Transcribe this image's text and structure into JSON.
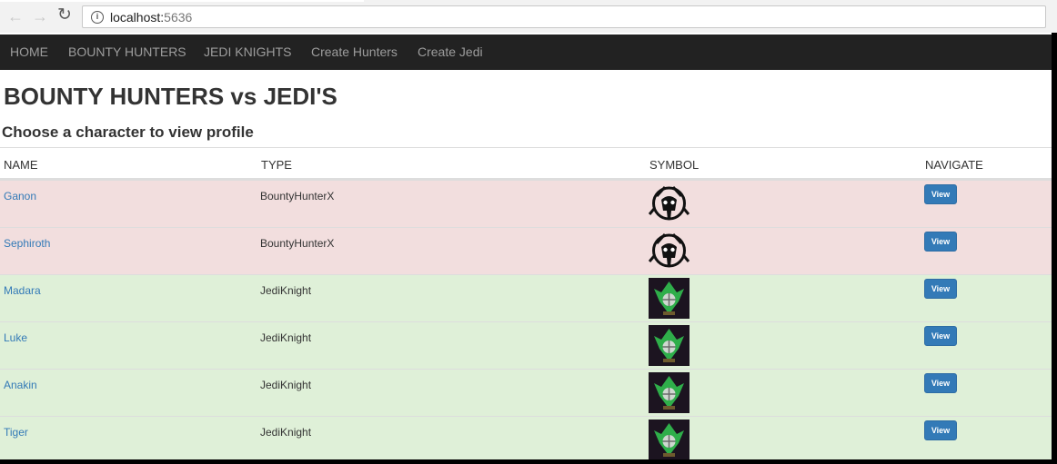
{
  "browser": {
    "url_host": "localhost:",
    "url_port": "5636",
    "icons": {
      "back": "arrow-left-icon",
      "forward": "arrow-right-icon",
      "reload": "reload-icon",
      "info": "info-icon"
    }
  },
  "navbar": {
    "links": [
      "HOME",
      "BOUNTY HUNTERS",
      "JEDI KNIGHTS",
      "Create Hunters",
      "Create Jedi"
    ]
  },
  "page": {
    "title": "BOUNTY HUNTERS vs JEDI'S",
    "subtitle": "Choose a character to view profile"
  },
  "table": {
    "headers": [
      "NAME",
      "TYPE",
      "SYMBOL",
      "NAVIGATE"
    ],
    "rows": [
      {
        "name": "Ganon",
        "type": "BountyHunterX",
        "symbol": "bounty-hunter-skull-emblem",
        "action": "View",
        "status": "danger"
      },
      {
        "name": "Sephiroth",
        "type": "BountyHunterX",
        "symbol": "bounty-hunter-skull-emblem",
        "action": "View",
        "status": "danger"
      },
      {
        "name": "Madara",
        "type": "JediKnight",
        "symbol": "jedi-crest-emblem",
        "action": "View",
        "status": "success"
      },
      {
        "name": "Luke",
        "type": "JediKnight",
        "symbol": "jedi-crest-emblem",
        "action": "View",
        "status": "success"
      },
      {
        "name": "Anakin",
        "type": "JediKnight",
        "symbol": "jedi-crest-emblem",
        "action": "View",
        "status": "success"
      },
      {
        "name": "Tiger",
        "type": "JediKnight",
        "symbol": "jedi-crest-emblem",
        "action": "View",
        "status": "success"
      }
    ],
    "colors": {
      "danger": "#f2dede",
      "success": "#dff0d8",
      "link": "#337ab7",
      "button": "#337ab7"
    }
  }
}
